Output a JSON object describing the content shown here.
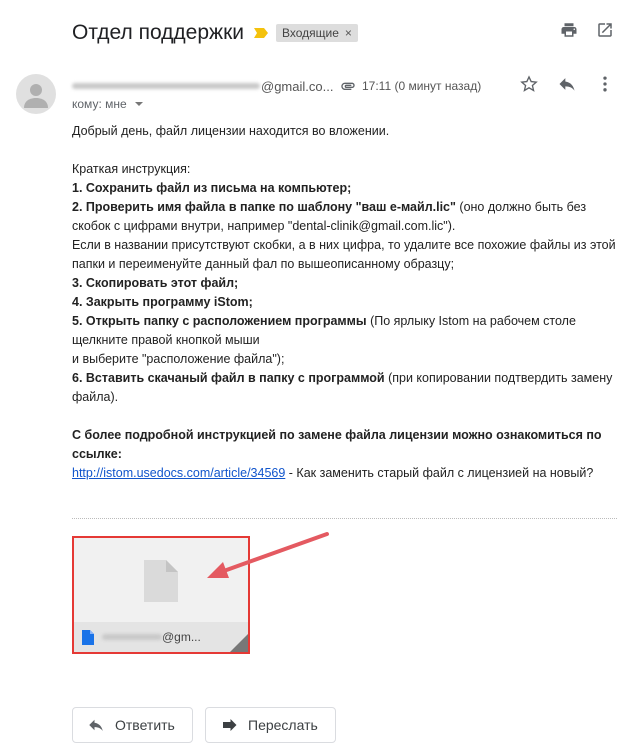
{
  "header": {
    "subject": "Отдел поддержки",
    "label": "Входящие",
    "label_close": "×"
  },
  "sender": {
    "email_suffix": "@gmail.co...",
    "time": "17:11 (0 минут назад)",
    "recipient": "кому: мне"
  },
  "message": {
    "greeting": "Добрый день, файл лицензии находится во вложении.",
    "intro": "Краткая инструкция:",
    "step1": "1. Сохранить файл из письма на компьютер;",
    "step2_bold": "2. Проверить имя файла в папке по шаблону \"ваш е-майл.lic\"",
    "step2_rest": " (оно должно быть без скобок с цифрами внутри, например \"dental-clinik@gmail.com.lic\").",
    "step2_note": "Если в названии присутствуют скобки, а в них цифра, то удалите все похожие файлы из этой папки и переименуйте данный фал по вышеописанному образцу;",
    "step3": "3. Скопировать этот файл;",
    "step4": "4. Закрыть программу iStom;",
    "step5_bold": "5. Открыть папку с расположением программы",
    "step5_rest": " (По ярлыку Istom на рабочем столе щелкните правой кнопкой мыши",
    "step5_cont": "и выберите \"расположение файла\");",
    "step6_bold": "6. Вставить скачаный файл в папку с программой",
    "step6_rest": " (при копировании подтвердить замену файла).",
    "more_info": "С более подробной инструкцией по замене файла лицензии можно ознакомиться по ссылке:",
    "link": "http://istom.usedocs.com/article/34569",
    "link_desc": " - Как заменить старый файл с лицензией на новый?"
  },
  "attachment": {
    "name_suffix": "@gm..."
  },
  "actions": {
    "reply": "Ответить",
    "forward": "Переслать"
  },
  "colors": {
    "highlight_border": "#e53935",
    "arrow": "#e45a61",
    "link": "#1155cc",
    "important_marker": "#f4c20d"
  }
}
